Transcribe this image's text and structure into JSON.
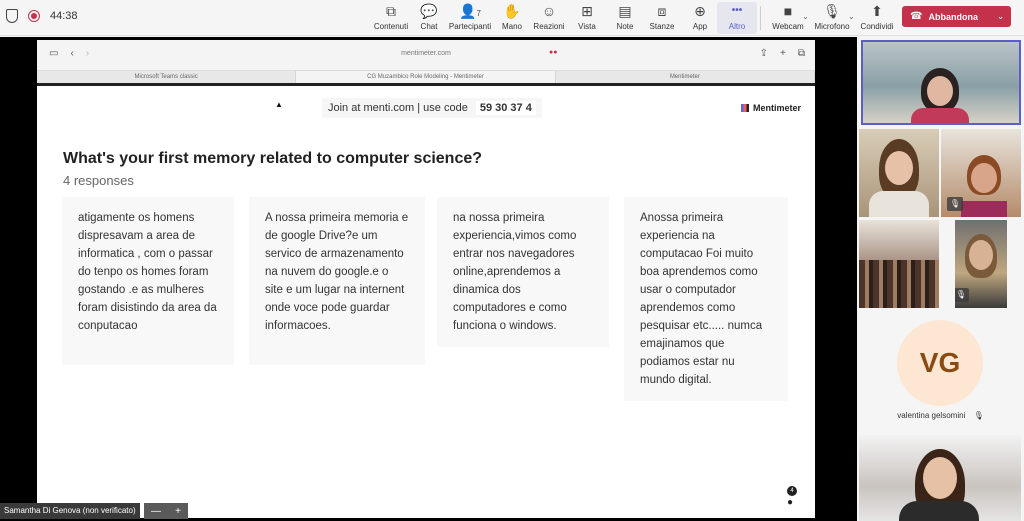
{
  "meeting": {
    "timer": "44:38",
    "toolbar": [
      {
        "id": "content",
        "label": "Contenuti",
        "icon": "share-screen-icon",
        "glyph": "⧉"
      },
      {
        "id": "chat",
        "label": "Chat",
        "icon": "chat-icon",
        "glyph": "💬"
      },
      {
        "id": "participants",
        "label": "Partecipanti",
        "icon": "people-icon",
        "glyph": "👤",
        "count": "7"
      },
      {
        "id": "hand",
        "label": "Mano",
        "icon": "raise-hand-icon",
        "glyph": "✋"
      },
      {
        "id": "reactions",
        "label": "Reazioni",
        "icon": "smiley-icon",
        "glyph": "☺"
      },
      {
        "id": "view",
        "label": "Vista",
        "icon": "grid-view-icon",
        "glyph": "⊞"
      },
      {
        "id": "notes",
        "label": "Note",
        "icon": "notes-icon",
        "glyph": "▤"
      },
      {
        "id": "rooms",
        "label": "Stanze",
        "icon": "rooms-icon",
        "glyph": "⧈"
      },
      {
        "id": "apps",
        "label": "App",
        "icon": "add-app-icon",
        "glyph": "⊕"
      },
      {
        "id": "more",
        "label": "Altro",
        "icon": "more-icon",
        "glyph": "•••"
      }
    ],
    "webcam_label": "Webcam",
    "mic_label": "Microfono",
    "share_label": "Condividi",
    "leave_label": "Abbandona"
  },
  "browser": {
    "url": "mentimeter.com",
    "tabs": [
      {
        "label": "Microsoft Teams classic"
      },
      {
        "label": "CG Muzambico Role Modeling - Mentimeter"
      },
      {
        "label": "Mentimeter"
      }
    ]
  },
  "slide": {
    "join_text": "Join at menti.com | use code",
    "code": "59 30 37 4",
    "brand": "Mentimeter",
    "question": "What's your first memory related to computer science?",
    "responses_count": "4 responses",
    "responses": [
      "atigamente os homens dispresavam a area de informatica , com o passar do tenpo os homes foram gostando .e as mulheres foram disistindo da area da conputacao",
      "A nossa primeira memoria e de google Drive?e um servico de armazenamento na nuvem do google.e o site e um lugar na internent onde voce pode guardar informacoes.",
      "na nossa primeira experiencia,vimos como entrar nos navegadores online,aprendemos a dinamica dos computadores e como funciona o windows.",
      "Anossa primeira experiencia na computacao Foi muito boa aprendemos como usar o computador aprendemos como pesquisar etc..... numca emajinamos que podiamos estar nu mundo digital."
    ],
    "participant_count": "4"
  },
  "presenter_tag": "Samantha Di Genova (non verificato)",
  "participants": {
    "avatar_initials": "VG",
    "avatar_name": "valentina gelsomini"
  }
}
